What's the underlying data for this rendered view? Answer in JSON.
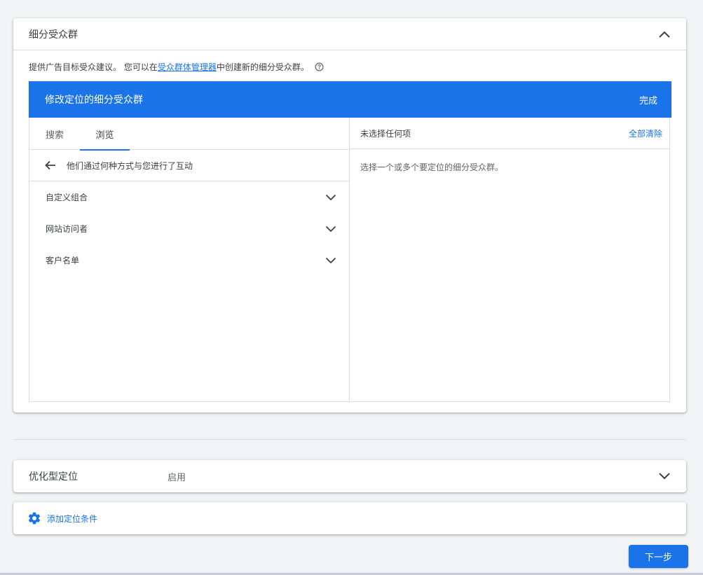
{
  "audience_section": {
    "title": "细分受众群",
    "description_prefix": "提供广告目标受众建议。 您可以在",
    "description_link": "受众群体管理器",
    "description_suffix": "中创建新的细分受众群。",
    "editor": {
      "title": "修改定位的细分受众群",
      "done_label": "完成",
      "tabs": [
        {
          "label": "搜索"
        },
        {
          "label": "浏览"
        }
      ],
      "active_tab": "浏览",
      "back_label": "他们通过何种方式与您进行了互动",
      "items": [
        {
          "label": "自定义组合"
        },
        {
          "label": "网站访问者"
        },
        {
          "label": "客户名单"
        }
      ],
      "selected_header": "未选择任何项",
      "clear_all_label": "全部清除",
      "empty_hint": "选择一个或多个要定位的细分受众群。"
    }
  },
  "optimized_targeting": {
    "title": "优化型定位",
    "value": "启用"
  },
  "add_targeting": {
    "label": "添加定位条件"
  },
  "next_button": {
    "label": "下一步"
  },
  "colors": {
    "accent": "#1a73e8",
    "background": "#f1f3f4",
    "text": "#3c4043",
    "divider": "#dadce0"
  }
}
